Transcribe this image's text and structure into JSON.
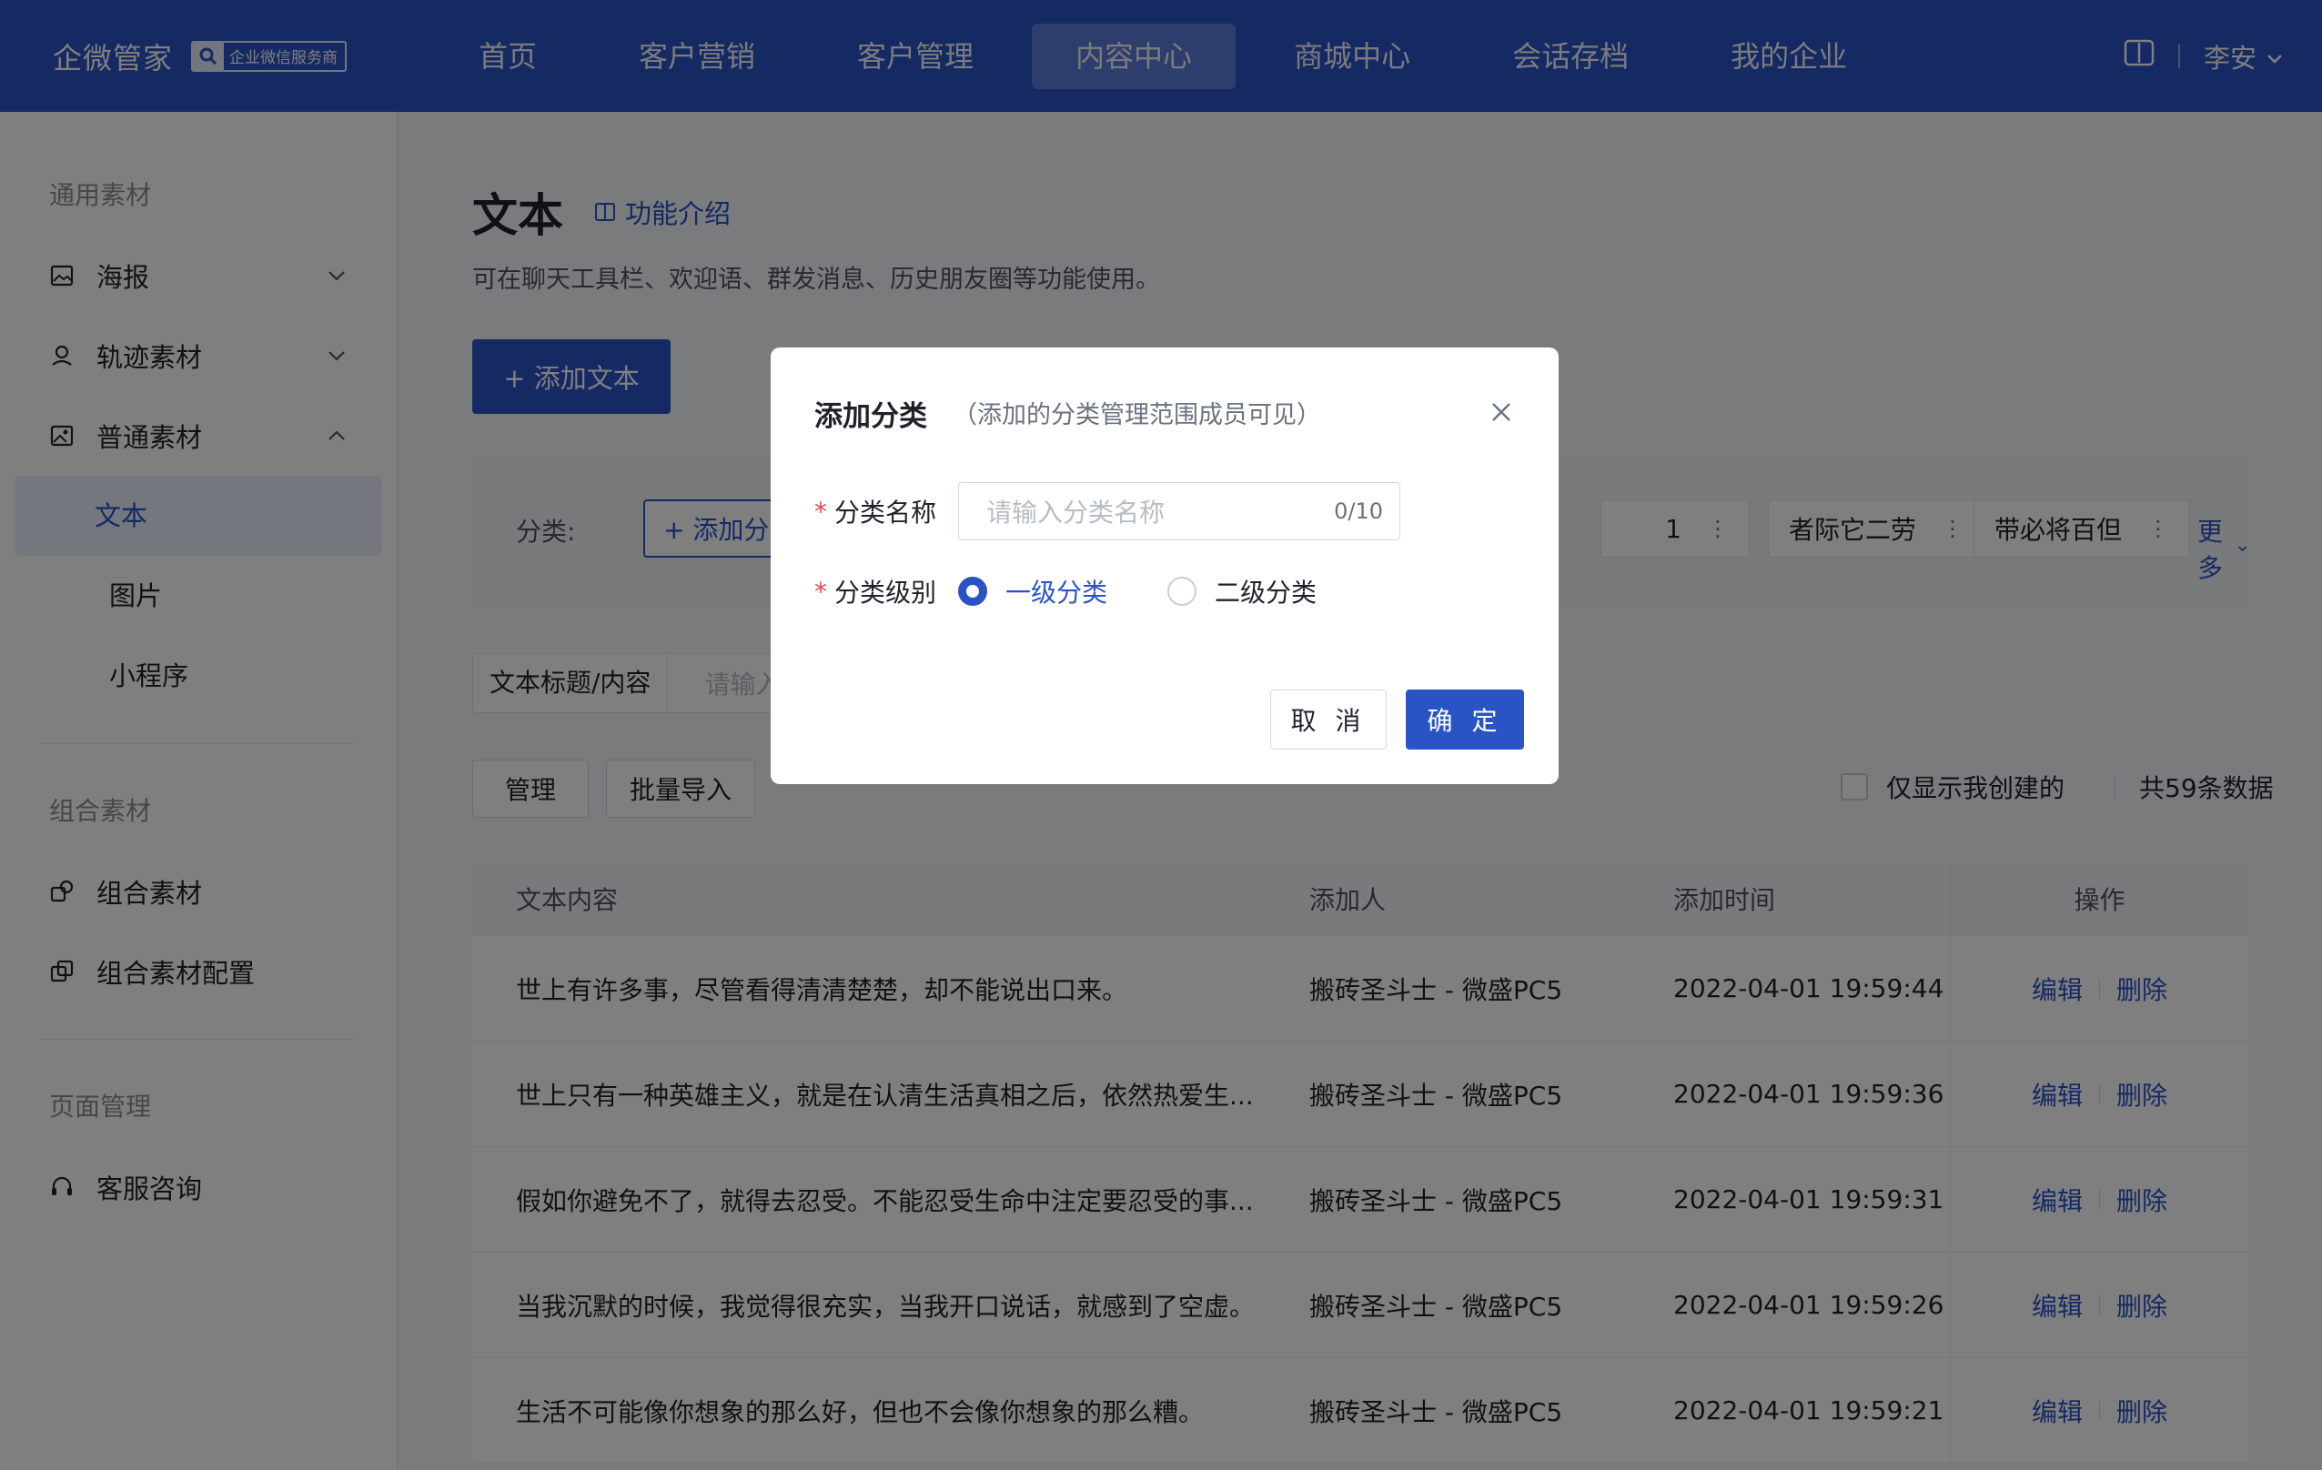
{
  "header": {
    "brand": "企微管家",
    "badge": "企业微信服务商",
    "nav": [
      "首页",
      "客户营销",
      "客户管理",
      "内容中心",
      "商城中心",
      "会话存档",
      "我的企业"
    ],
    "active_nav": "内容中心",
    "user": "李安"
  },
  "sidebar": {
    "group1": "通用素材",
    "items1": [
      {
        "label": "海报",
        "icon": "image-icon",
        "chevron": "down"
      },
      {
        "label": "轨迹素材",
        "icon": "user-location-icon",
        "chevron": "down"
      },
      {
        "label": "普通素材",
        "icon": "gallery-icon",
        "chevron": "up"
      }
    ],
    "subitems": [
      "文本",
      "图片",
      "小程序"
    ],
    "active_sub": "文本",
    "group2": "组合素材",
    "items2": [
      {
        "label": "组合素材",
        "icon": "combine-icon"
      },
      {
        "label": "组合素材配置",
        "icon": "copy-config-icon"
      }
    ],
    "group3": "页面管理",
    "items3": [
      {
        "label": "客服咨询",
        "icon": "headset-icon"
      }
    ]
  },
  "main": {
    "title": "文本",
    "intro_link": "功能介绍",
    "description": "可在聊天工具栏、欢迎语、群发消息、历史朋友圈等功能使用。",
    "add_button": "+ 添加文本",
    "category_label": "分类:",
    "category_add": "+ 添加分类",
    "category_tags": [
      "1",
      "者际它二劳",
      "带必将百但"
    ],
    "more": "更多",
    "search_label": "文本标题/内容",
    "search_placeholder": "请输入关键字",
    "manage_button": "管理",
    "import_button": "批量导入",
    "only_mine": "仅显示我创建的",
    "total": "共59条数据"
  },
  "table": {
    "headers": [
      "文本内容",
      "添加人",
      "添加时间",
      "操作"
    ],
    "rows": [
      {
        "content": "世上有许多事，尽管看得清清楚楚，却不能说出口来。",
        "author": "搬砖圣斗士 - 微盛PC5",
        "time": "2022-04-01 19:59:44"
      },
      {
        "content": "世上只有一种英雄主义，就是在认清生活真相之后，依然热爱生...",
        "author": "搬砖圣斗士 - 微盛PC5",
        "time": "2022-04-01 19:59:36"
      },
      {
        "content": "假如你避免不了，就得去忍受。不能忍受生命中注定要忍受的事...",
        "author": "搬砖圣斗士 - 微盛PC5",
        "time": "2022-04-01 19:59:31"
      },
      {
        "content": "当我沉默的时候，我觉得很充实，当我开口说话，就感到了空虚。",
        "author": "搬砖圣斗士 - 微盛PC5",
        "time": "2022-04-01 19:59:26"
      },
      {
        "content": "生活不可能像你想象的那么好，但也不会像你想象的那么糟。",
        "author": "搬砖圣斗士 - 微盛PC5",
        "time": "2022-04-01 19:59:21"
      }
    ],
    "edit": "编辑",
    "delete": "删除"
  },
  "modal": {
    "title": "添加分类",
    "subtitle": "（添加的分类管理范围成员可见）",
    "name_label": "分类名称",
    "name_placeholder": "请输入分类名称",
    "name_count": "0/10",
    "level_label": "分类级别",
    "level_options": [
      "一级分类",
      "二级分类"
    ],
    "level_selected": "一级分类",
    "cancel": "取 消",
    "confirm": "确 定"
  },
  "colors": {
    "primary": "#2a53c6",
    "required": "#e5484d"
  }
}
